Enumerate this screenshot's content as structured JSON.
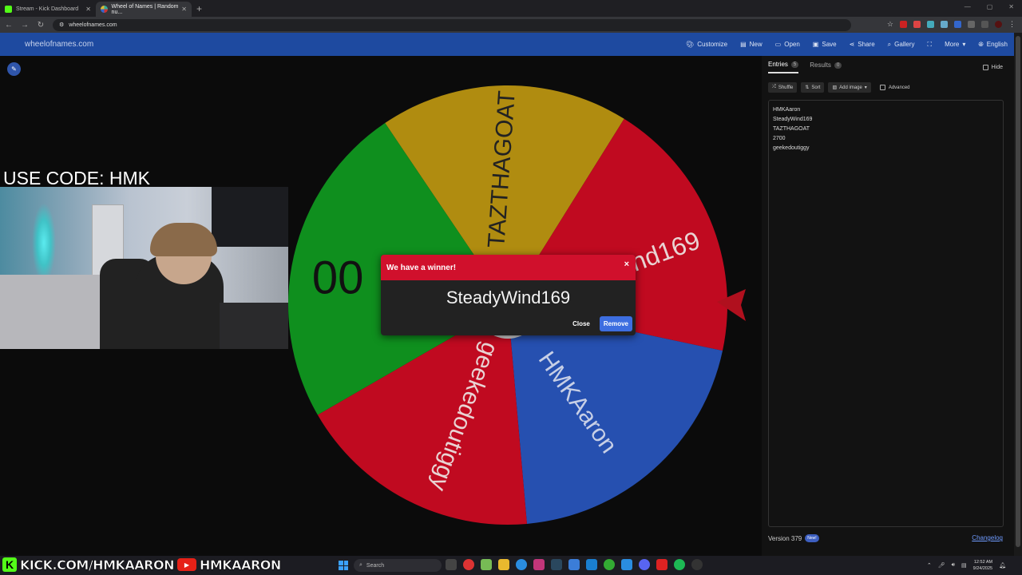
{
  "browser": {
    "tabs": [
      {
        "label": "Stream - Kick Dashboard",
        "fav_color": "#53fc18",
        "active": false
      },
      {
        "label": "Wheel of Names | Random nu...",
        "fav_color": "#e44",
        "active": true
      }
    ],
    "new_tab": "+",
    "url": "wheelofnames.com"
  },
  "site": {
    "name": "wheelofnames.com",
    "menu": [
      {
        "icon": "palette-icon",
        "label": "Customize"
      },
      {
        "icon": "file-icon",
        "label": "New"
      },
      {
        "icon": "folder-icon",
        "label": "Open"
      },
      {
        "icon": "save-icon",
        "label": "Save"
      },
      {
        "icon": "share-icon",
        "label": "Share"
      },
      {
        "icon": "search-icon",
        "label": "Gallery"
      },
      {
        "icon": "fullscreen-icon",
        "label": ""
      },
      {
        "icon": "chevron-down-icon",
        "label": "More"
      },
      {
        "icon": "globe-icon",
        "label": "English"
      }
    ]
  },
  "stream_overlay": {
    "code_text": "USE CODE: HMK",
    "kick_text": "KICK.COM/HMKAARON",
    "youtube_text": "HMKAARON"
  },
  "wheel": {
    "colors": {
      "green": "#0f8f1e",
      "yellow": "#b08c10",
      "red": "#c00a20",
      "blue": "#2650b0"
    },
    "segments": [
      {
        "label": "TAZTHAGOAT",
        "color": "#b08c10"
      },
      {
        "label": "SteadyWind169",
        "color": "#c00a20"
      },
      {
        "label": "HMKAaron",
        "color": "#2650b0"
      },
      {
        "label": "geekedoutiggy",
        "color": "#c00a20"
      },
      {
        "label": "2700",
        "color": "#0f8f1e"
      }
    ],
    "visible_fragments": {
      "green": "00",
      "red": "Wind169"
    }
  },
  "dialog": {
    "title": "We have a winner!",
    "winner": "SteadyWind169",
    "close_label": "Close",
    "remove_label": "Remove",
    "close_x": "×"
  },
  "panel": {
    "tabs": [
      {
        "label": "Entries",
        "count": "5"
      },
      {
        "label": "Results",
        "count": "0"
      }
    ],
    "hide_label": "Hide",
    "toolbar": {
      "shuffle": "Shuffle",
      "sort": "Sort",
      "add_image": "Add image",
      "advanced": "Advanced"
    },
    "entries": [
      "HMKAaron",
      "SteadyWind169",
      "TAZTHAGOAT",
      "2700",
      "geekedoutiggy"
    ],
    "version": "Version 379",
    "new_badge": "New!",
    "changelog": "Changelog"
  },
  "taskbar": {
    "search_placeholder": "Search",
    "time": "12:52 AM",
    "date": "9/24/2025"
  }
}
